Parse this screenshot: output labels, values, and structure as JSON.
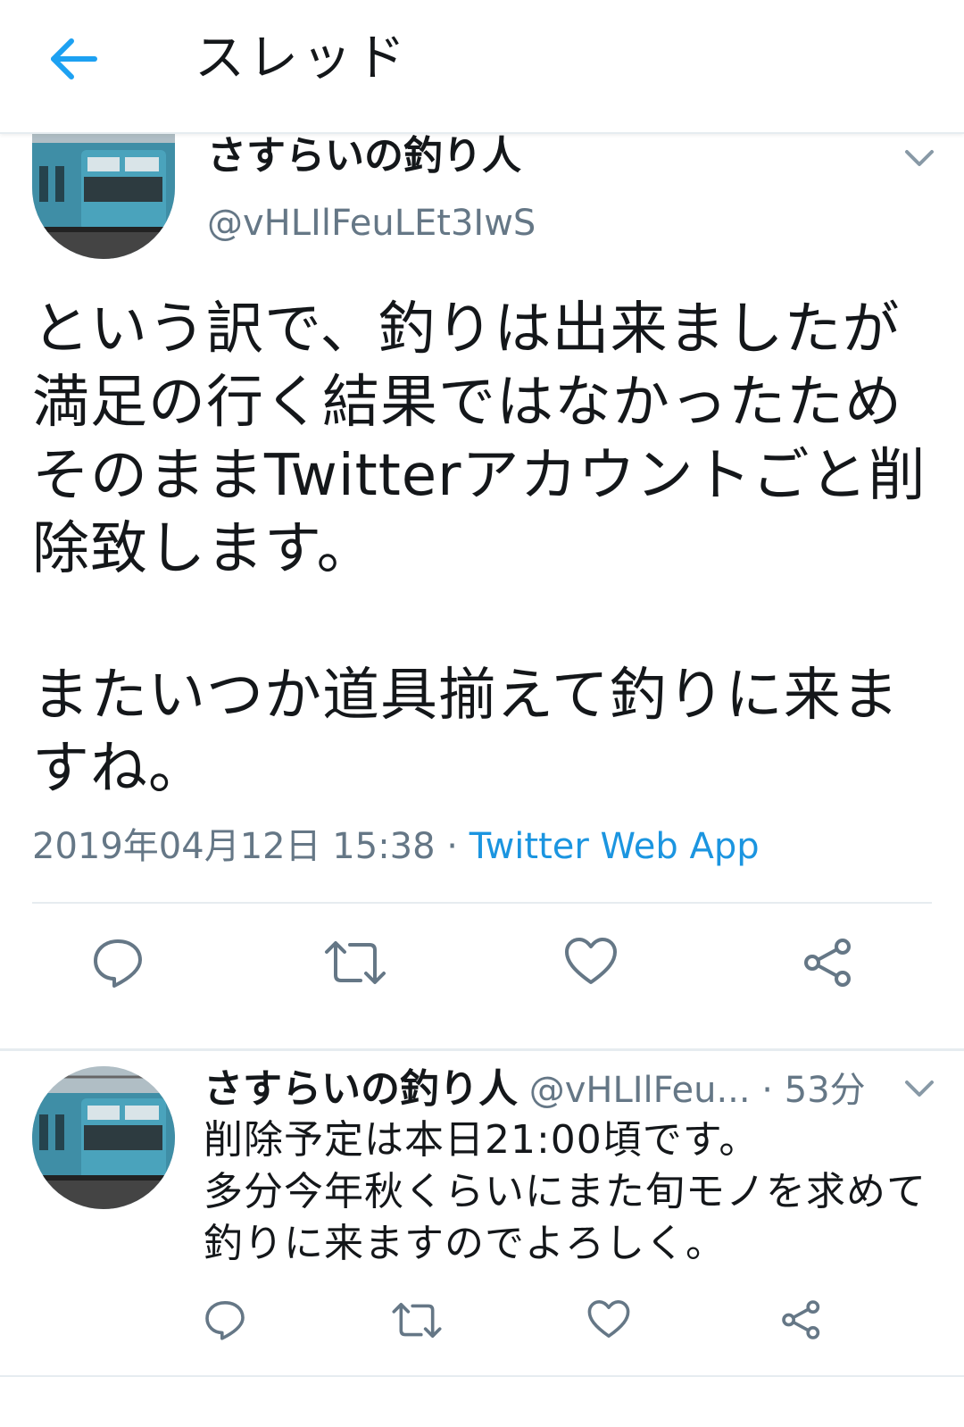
{
  "header": {
    "title": "スレッド",
    "back_icon": "arrow-left-icon",
    "accent": "#1da1f2"
  },
  "main_tweet": {
    "display_name": "さすらいの釣り人",
    "handle": "@vHLIlFeuLEt3IwS",
    "text": "という訳で、釣りは出来ましたが満足の行く結果ではなかったためそのままTwitterアカウントごと削除致します。\n\nまたいつか道具揃えて釣りに来ますね。",
    "timestamp": "2019年04月12日 15:38",
    "separator": " · ",
    "source": "Twitter Web App",
    "actions": [
      "reply-icon",
      "retweet-icon",
      "like-icon",
      "share-icon"
    ]
  },
  "reply_tweet": {
    "display_name": "さすらいの釣り人",
    "handle": "@vHLIlFeu...",
    "separator": " · ",
    "time": "53分",
    "text": "削除予定は本日21:00頃です。\n多分今年秋くらいにまた旬モノを求めて釣りに来ますのでよろしく。",
    "actions": [
      "reply-icon",
      "retweet-icon",
      "like-icon",
      "share-icon"
    ]
  },
  "colors": {
    "text": "#14171a",
    "secondary": "#657786",
    "link": "#1b95e0",
    "divider": "#e6ecf0"
  }
}
